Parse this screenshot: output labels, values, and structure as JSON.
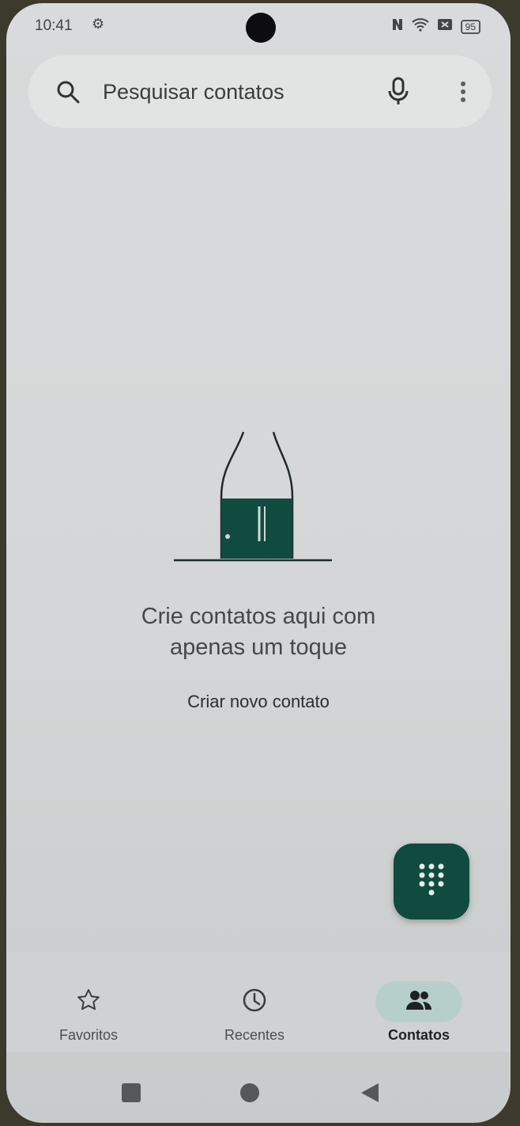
{
  "status_bar": {
    "time": "10:41",
    "battery": "95"
  },
  "search": {
    "placeholder": "Pesquisar contatos"
  },
  "empty_state": {
    "title_line1": "Crie contatos aqui com",
    "title_line2": "apenas um toque",
    "action": "Criar novo contato"
  },
  "bottom_nav": {
    "favorites": "Favoritos",
    "recents": "Recentes",
    "contacts": "Contatos"
  },
  "icons": {
    "search": "search-icon",
    "mic": "mic-icon",
    "more": "more-vert-icon",
    "dialpad": "dialpad-icon",
    "star": "star-icon",
    "clock": "clock-icon",
    "people": "people-icon"
  },
  "colors": {
    "fab": "#0f4b3f",
    "active_pill": "#b7cfcb",
    "illustration": "#0f4b3f"
  }
}
